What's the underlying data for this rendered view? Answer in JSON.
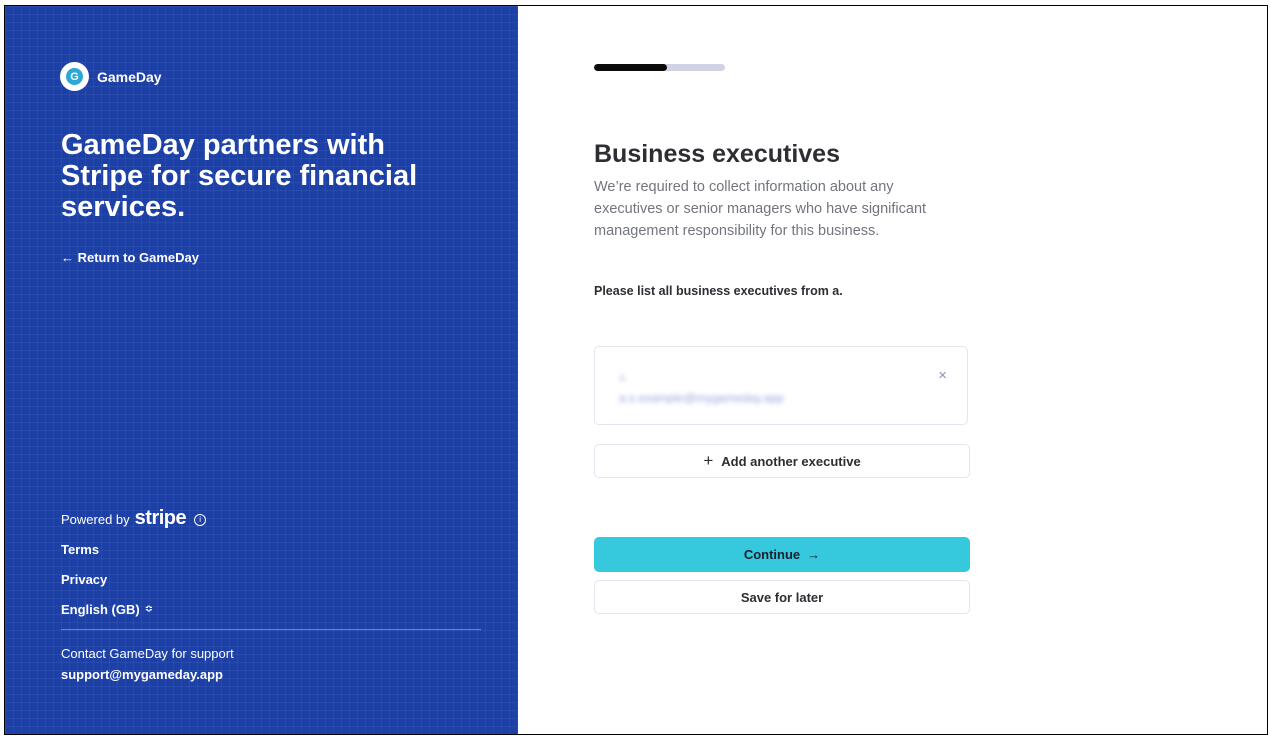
{
  "sidebar": {
    "brand_name": "GameDay",
    "brand_logo_letter": "G",
    "headline": "GameDay partners with Stripe for secure financial services.",
    "return_link": "← Return to GameDay",
    "powered_by": "Powered by",
    "powered_brand": "stripe",
    "info_icon_glyph": "ⓘ",
    "terms": "Terms",
    "privacy": "Privacy",
    "language": "English (GB)",
    "language_chevron": "≎",
    "contact_text": "Contact GameDay for support",
    "contact_email": "support@mygameday.app",
    "bg_color": "#1c40a6"
  },
  "progress": {
    "value": 0.56
  },
  "main": {
    "title": "Business executives",
    "description": "We’re required to collect information about any executives or senior managers who have significant management responsibility for this business.",
    "instruction": "Please list all business executives from a.",
    "executives": [
      {
        "name": "a",
        "email": "a.s.example@mygameday.app"
      }
    ],
    "remove_icon": "×",
    "add_icon": "+",
    "add_label": "Add another executive",
    "continue_label": "Continue",
    "continue_arrow": "→",
    "continue_color": "#36c8dc",
    "save_label": "Save for later"
  }
}
